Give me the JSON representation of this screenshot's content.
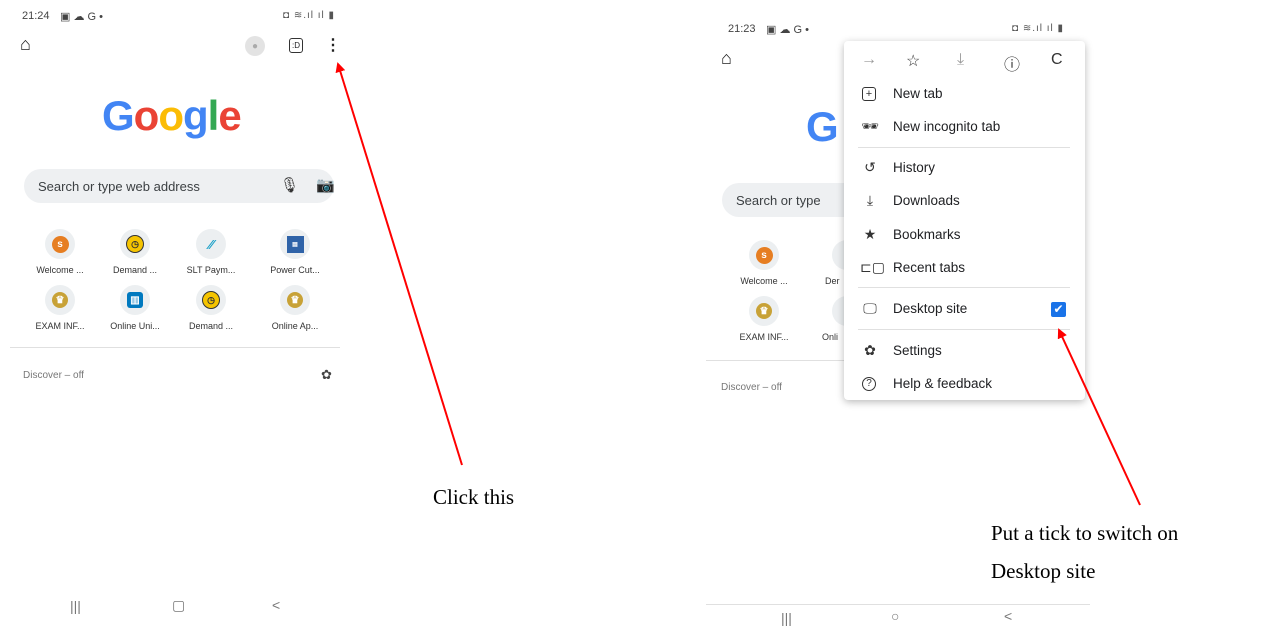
{
  "left_phone": {
    "status_time": "21:24",
    "status_icons": "▣ ☁ G •",
    "status_right": "◘ ≋.ıl ıl ▮",
    "google_logo": {
      "letters": [
        "G",
        "o",
        "o",
        "g",
        "l",
        "e"
      ],
      "colors": [
        "#4285F4",
        "#EA4335",
        "#FBBC05",
        "#4285F4",
        "#34A853",
        "#EA4335"
      ]
    },
    "search_placeholder": "Search or type web address",
    "shortcuts": [
      {
        "label": "Welcome ...",
        "icon": "s"
      },
      {
        "label": "Demand ...",
        "icon": "clock"
      },
      {
        "label": "SLT Paym...",
        "icon": "slt"
      },
      {
        "label": "Power Cut...",
        "icon": "tamil"
      },
      {
        "label": "EXAM INF...",
        "icon": "emblem"
      },
      {
        "label": "Online Uni...",
        "icon": "trello"
      },
      {
        "label": "Demand ...",
        "icon": "clock"
      },
      {
        "label": "Online Ap...",
        "icon": "emblem"
      }
    ],
    "discover": "Discover – off",
    "nav": [
      "|||",
      "▢",
      "<"
    ]
  },
  "right_phone": {
    "status_time": "21:23",
    "status_icons": "▣ ☁ G •",
    "status_right": "◘ ≋.ıl ıl ▮",
    "google_partial": "G",
    "search_partial": "Search or type",
    "shortcuts": [
      {
        "label": "Welcome ...",
        "icon": "s"
      },
      {
        "label": "Der",
        "icon": ""
      },
      {
        "label": "EXAM INF...",
        "icon": "emblem"
      },
      {
        "label": "Onli",
        "icon": ""
      }
    ],
    "discover": "Discover – off",
    "nav": [
      "|||",
      "○",
      "<"
    ]
  },
  "menu": {
    "toolbar": [
      "→",
      "☆",
      "⤓",
      "ⓘ",
      "C"
    ],
    "items": [
      {
        "label": "New tab",
        "icon": "new-tab-icon"
      },
      {
        "label": "New incognito tab",
        "icon": "incognito-icon"
      },
      {
        "label": "History",
        "icon": "history-icon"
      },
      {
        "label": "Downloads",
        "icon": "downloads-icon"
      },
      {
        "label": "Bookmarks",
        "icon": "bookmarks-icon"
      },
      {
        "label": "Recent tabs",
        "icon": "recent-tabs-icon"
      },
      {
        "label": "Desktop site",
        "icon": "desktop-icon",
        "checked": true
      },
      {
        "label": "Settings",
        "icon": "settings-icon"
      },
      {
        "label": "Help & feedback",
        "icon": "help-icon"
      }
    ]
  },
  "annotations": {
    "click_this": "Click this",
    "tick_line1": "Put a tick to switch on",
    "tick_line2": "Desktop site",
    "arrow_color": "#ff0000"
  }
}
